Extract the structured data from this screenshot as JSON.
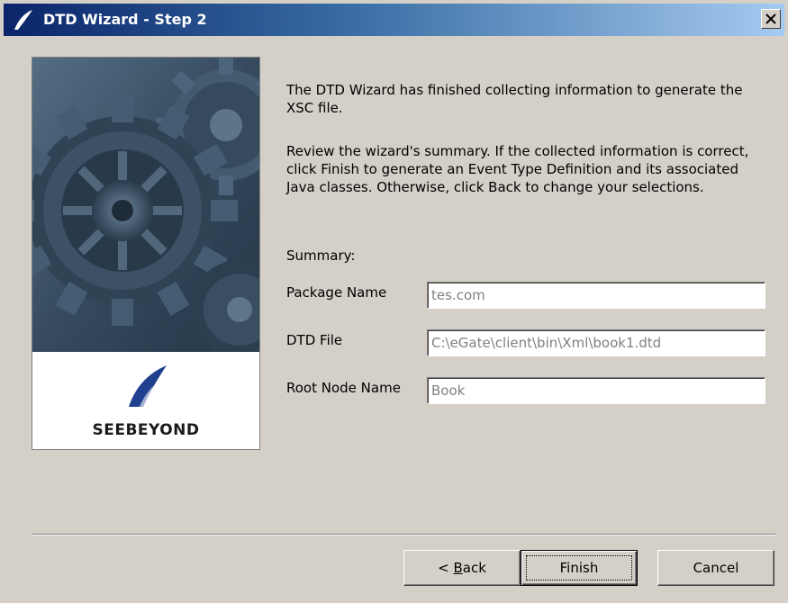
{
  "window": {
    "title": "DTD Wizard - Step 2"
  },
  "side_panel": {
    "brand_name": "SeeBeyond",
    "brand_display": "SEEBEYOND",
    "image": "gears-illustration"
  },
  "content": {
    "intro": "The DTD Wizard has finished collecting information to generate the XSC file.",
    "instructions": "Review the wizard's summary.  If the collected information is correct, click Finish to generate an Event Type Definition and its associated Java classes.  Otherwise, click Back to change your selections.",
    "summary_label": "Summary:"
  },
  "summary": {
    "package_name": {
      "label": "Package Name",
      "value": "tes.com"
    },
    "dtd_file": {
      "label": "DTD File",
      "value": "C:\\eGate\\client\\bin\\Xml\\book1.dtd"
    },
    "root_node_name": {
      "label": "Root Node Name",
      "value": "Book"
    }
  },
  "buttons": {
    "back_prefix": "< ",
    "back_mnemonic": "B",
    "back_rest": "ack",
    "finish": "Finish",
    "cancel": "Cancel"
  },
  "colors": {
    "title_gradient_start": "#0a246a",
    "title_gradient_end": "#a6caf0",
    "dialog_bg": "#d4d0c8",
    "brand_blue": "#1f3f8f"
  },
  "icons": {
    "title": "seebeyond-logo-icon",
    "close": "close-icon"
  }
}
